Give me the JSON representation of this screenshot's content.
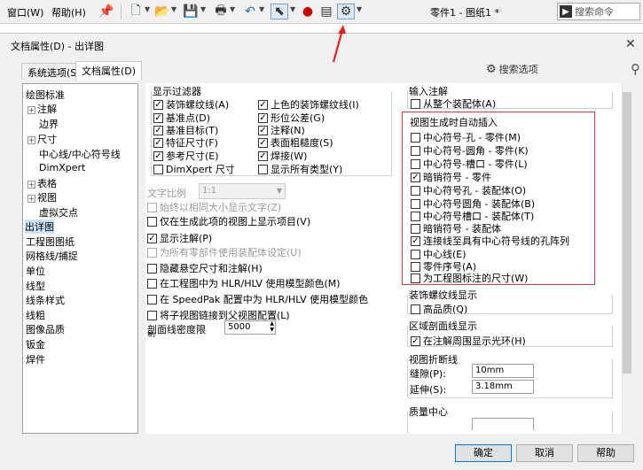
{
  "menu": {
    "window": "窗口(W)",
    "help": "帮助(H)"
  },
  "doc_title": "零件1 - 图纸1 *",
  "search_cmd": "搜索命令",
  "dialog": {
    "title": "文档属性(D) - 出详图",
    "close": "✕"
  },
  "tabs": {
    "system": "系统选项(S)",
    "doc": "文档属性(D)"
  },
  "search_options": "搜索选项",
  "tree": [
    "绘图标准",
    "注解",
    "边界",
    "尺寸",
    "中心线/中心符号线",
    "DimXpert",
    "表格",
    "视图",
    "虚拟交点",
    "出详图",
    "工程图图纸",
    "网格线/捕捉",
    "单位",
    "线型",
    "线条样式",
    "线粗",
    "图像品质",
    "钣金",
    "焊件"
  ],
  "display_filter": {
    "title": "显示过滤器",
    "items": [
      "装饰螺纹线(A)",
      "基准点(D)",
      "基准目标(T)",
      "特征尺寸(F)",
      "参考尺寸(E)",
      "DimXpert 尺寸"
    ],
    "items2": [
      "上色的装饰螺纹线(I)",
      "形位公差(G)",
      "注释(N)",
      "表面粗糙度(S)",
      "焊接(W)",
      "显示所有类型(Y)"
    ]
  },
  "text_scale": {
    "label": "文字比例",
    "value": "1:1"
  },
  "opts": [
    "始终以相同大小显示文字(Z)",
    "仅在生成此项的视图上显示项目(V)",
    "显示注解(P)",
    "为所有零部件使用装配体设定(U)",
    "隐藏悬空尺寸和注解(H)",
    "在工程图中为 HLR/HLV 使用模型颜色(M)",
    "在 SpeedPak 配置中为 HLR/HLV 使用模型颜色",
    "将子视图链接到父视图配置(L)"
  ],
  "hatch": {
    "label": "剖面线密度限",
    "label2": "制",
    "value": "5000"
  },
  "input_notes": {
    "title": "输入注解",
    "item": "从整个装配体(A)"
  },
  "auto_insert": {
    "title": "视图生成时自动插入",
    "items": [
      "中心符号-孔 - 零件(M)",
      "中心符号-圆角 - 零件(K)",
      "中心符号-槽口 - 零件(L)",
      "暗销符号 - 零件",
      "中心符号孔 - 装配体(O)",
      "中心符号圆角 - 装配体(B)",
      "中心符号槽口 - 装配体(T)",
      "暗销符号 - 装配体",
      "连接线至具有中心符号线的孔阵列",
      "中心线(E)",
      "零件序号(A)",
      "为工程图标注的尺寸(W)"
    ]
  },
  "cosmetic": {
    "title": "装饰螺纹线显示",
    "item": "高品质(Q)"
  },
  "area_hatch": {
    "title": "区域剖面线显示",
    "item": "在注解周围显示光环(H)"
  },
  "break_line": {
    "title": "视图折断线",
    "gap_label": "缝隙(P):",
    "gap": "10mm",
    "ext_label": "延伸(S):",
    "ext": "3.18mm"
  },
  "mass": {
    "title": "质量中心"
  },
  "buttons": {
    "ok": "确定",
    "cancel": "取消",
    "help": "帮助"
  }
}
